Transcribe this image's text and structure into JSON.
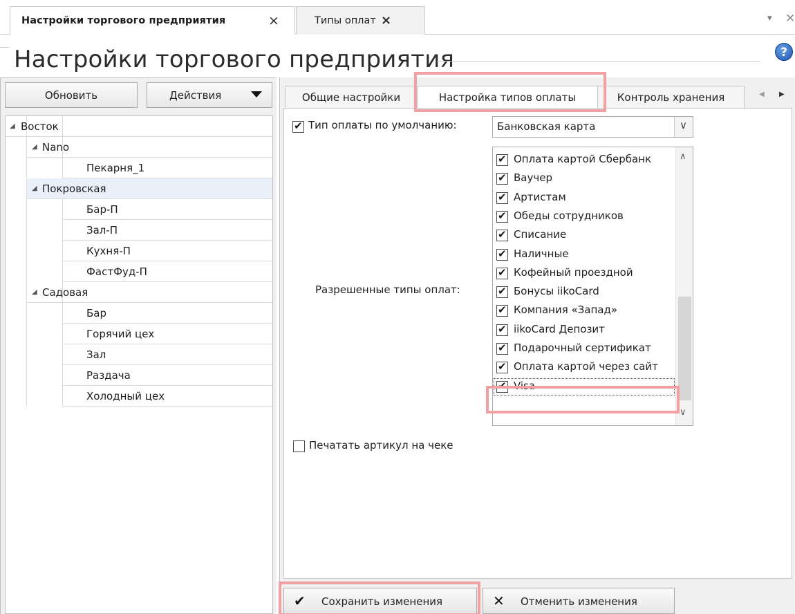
{
  "doc_tabs": [
    {
      "label": "Настройки торгового предприятия",
      "close": "×"
    },
    {
      "label": "Типы оплат",
      "close": "×"
    }
  ],
  "strip": {
    "menu_glyph": "▾",
    "close_glyph": "×"
  },
  "page_title": "Настройки торгового предприятия",
  "help_glyph": "?",
  "left_toolbar": {
    "refresh": "Обновить",
    "actions": "Действия"
  },
  "tree": [
    {
      "label": "Восток",
      "level": 0,
      "expanded": true
    },
    {
      "label": "Nano",
      "level": 1,
      "expanded": true
    },
    {
      "label": "Пекарня_1",
      "level": 2
    },
    {
      "label": "Покровская",
      "level": 1,
      "expanded": true,
      "selected": true
    },
    {
      "label": "Бар-П",
      "level": 2
    },
    {
      "label": "Зал-П",
      "level": 2
    },
    {
      "label": "Кухня-П",
      "level": 2
    },
    {
      "label": "ФастФуд-П",
      "level": 2
    },
    {
      "label": "Садовая",
      "level": 1,
      "expanded": true
    },
    {
      "label": "Бар",
      "level": 2
    },
    {
      "label": "Горячий цех",
      "level": 2
    },
    {
      "label": "Зал",
      "level": 2
    },
    {
      "label": "Раздача",
      "level": 2
    },
    {
      "label": "Холодный цех",
      "level": 2
    }
  ],
  "settings_tabs": [
    "Общие настройки",
    "Настройка типов оплаты",
    "Контроль хранения"
  ],
  "active_settings_tab": "Настройка типов оплаты",
  "tab_scroll": {
    "left": "◀",
    "right": "▶"
  },
  "default_payment": {
    "checked": true,
    "label": "Тип оплаты по умолчанию:",
    "value": "Банковская карта"
  },
  "allowed_label": "Разрешенные типы оплат:",
  "allowed_types": [
    {
      "label": "Оплата картой Сбербанк",
      "checked": true
    },
    {
      "label": "Ваучер",
      "checked": true
    },
    {
      "label": "Артистам",
      "checked": true
    },
    {
      "label": "Обеды сотрудников",
      "checked": true
    },
    {
      "label": "Списание",
      "checked": true
    },
    {
      "label": "Наличные",
      "checked": true
    },
    {
      "label": "Кофейный проездной",
      "checked": true
    },
    {
      "label": "Бонусы iikoCard",
      "checked": true
    },
    {
      "label": "Компания «Запад»",
      "checked": true
    },
    {
      "label": "iikoCard Депозит",
      "checked": true
    },
    {
      "label": "Подарочный сертификат",
      "checked": true
    },
    {
      "label": "Оплата картой через сайт",
      "checked": true
    },
    {
      "label": "Visa",
      "checked": true,
      "focused": true
    }
  ],
  "list_scroll": {
    "up": "∧",
    "down": "∨"
  },
  "print_article": {
    "checked": false,
    "label": "Печатать артикул на чеке"
  },
  "bottom": {
    "save": {
      "label": "Сохранить изменения",
      "icon": "✔"
    },
    "cancel": {
      "label": "Отменить изменения",
      "icon": "✕"
    }
  },
  "colors": {
    "highlight": "#f2a0a3",
    "selected_row": "#e9f0fa"
  }
}
